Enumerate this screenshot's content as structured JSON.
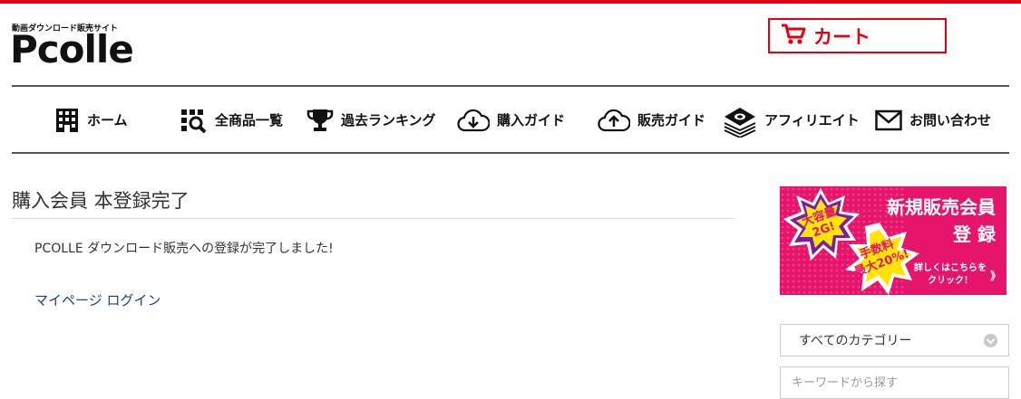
{
  "header": {
    "tagline": "動画ダウンロード販売サイト",
    "logo": "Pcolle",
    "cart_label": "カート"
  },
  "nav": {
    "items": [
      {
        "label": "ホーム",
        "icon": "building-icon"
      },
      {
        "label": "全商品一覧",
        "icon": "grid-search-icon"
      },
      {
        "label": "過去ランキング",
        "icon": "trophy-icon"
      },
      {
        "label": "購入ガイド",
        "icon": "cloud-download-icon"
      },
      {
        "label": "販売ガイド",
        "icon": "cloud-upload-icon"
      },
      {
        "label": "アフィリエイト",
        "icon": "money-stack-icon"
      },
      {
        "label": "お問い合わせ",
        "icon": "envelope-icon"
      }
    ]
  },
  "main": {
    "title": "購入会員 本登録完了",
    "message": "PCOLLE ダウンロード販売への登録が完了しました!",
    "mypage_link": "マイページ ログイン"
  },
  "sidebar": {
    "banner": {
      "headline1": "新規販売会員",
      "headline2": "登 録",
      "badge1_line1": "大容量",
      "badge1_line2": "2G!",
      "badge2_line1": "手数料",
      "badge2_line2": "最大20%!",
      "cta_line1": "詳しくはこちらを",
      "cta_line2": "クリック！",
      "arrow": "》",
      "bg_color": "#e5156b"
    },
    "category_select": "すべてのカテゴリー",
    "search_placeholder": "キーワードから探す"
  },
  "colors": {
    "accent": "#e60012",
    "link": "#1f3d8f"
  }
}
